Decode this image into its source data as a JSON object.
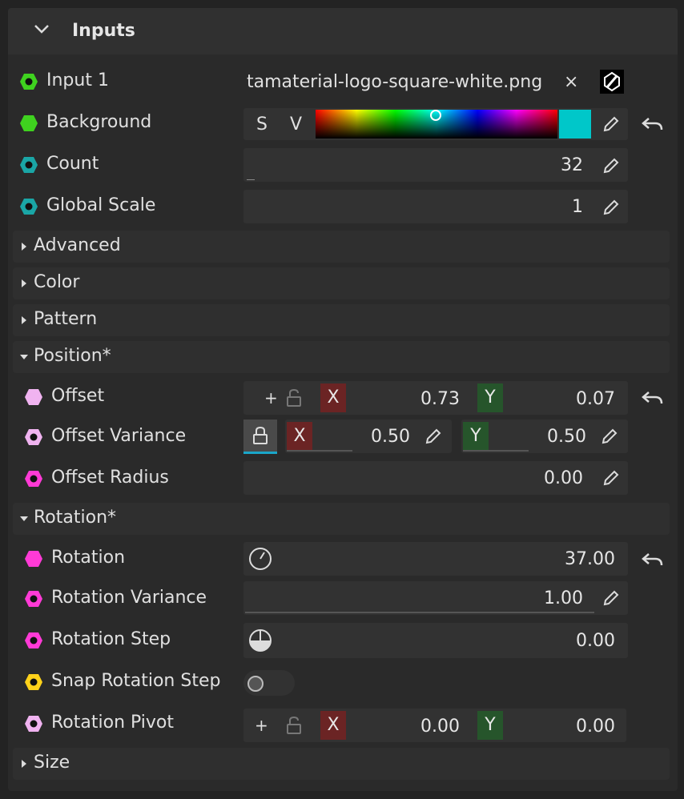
{
  "panel": {
    "title": "Inputs"
  },
  "inputs": {
    "input1": {
      "label": "Input 1",
      "file": "tamaterial-logo-square-white.png"
    },
    "background": {
      "label": "Background",
      "s_label": "S",
      "v_label": "V",
      "swatch": "#00c7c9"
    },
    "count": {
      "label": "Count",
      "value": "32"
    },
    "global_scale": {
      "label": "Global Scale",
      "value": "1"
    }
  },
  "sections": {
    "advanced": "Advanced",
    "color": "Color",
    "pattern": "Pattern",
    "position": "Position*",
    "rotation": "Rotation*",
    "size": "Size"
  },
  "position": {
    "offset": {
      "label": "Offset",
      "plus": "+",
      "x_label": "X",
      "x": "0.73",
      "y_label": "Y",
      "y": "0.07"
    },
    "offset_variance": {
      "label": "Offset Variance",
      "x_label": "X",
      "x": "0.50",
      "y_label": "Y",
      "y": "0.50"
    },
    "offset_radius": {
      "label": "Offset Radius",
      "value": "0.00"
    }
  },
  "rotation": {
    "rotation": {
      "label": "Rotation",
      "value": "37.00"
    },
    "rotation_variance": {
      "label": "Rotation Variance",
      "value": "1.00"
    },
    "rotation_step": {
      "label": "Rotation Step",
      "value": "0.00"
    },
    "snap_rotation_step": {
      "label": "Snap Rotation Step",
      "enabled": false
    },
    "rotation_pivot": {
      "label": "Rotation Pivot",
      "plus": "+",
      "x_label": "X",
      "x": "0.00",
      "y_label": "Y",
      "y": "0.00"
    }
  },
  "colors": {
    "green_socket": "#3fd21f",
    "teal_socket": "#1aa6a6",
    "pink_socket": "#ff3ad6",
    "light_pink_socket": "#f0b3f0",
    "yellow_socket": "#ffd21a",
    "x_axis": "#6b2424",
    "y_axis": "#26552b"
  }
}
